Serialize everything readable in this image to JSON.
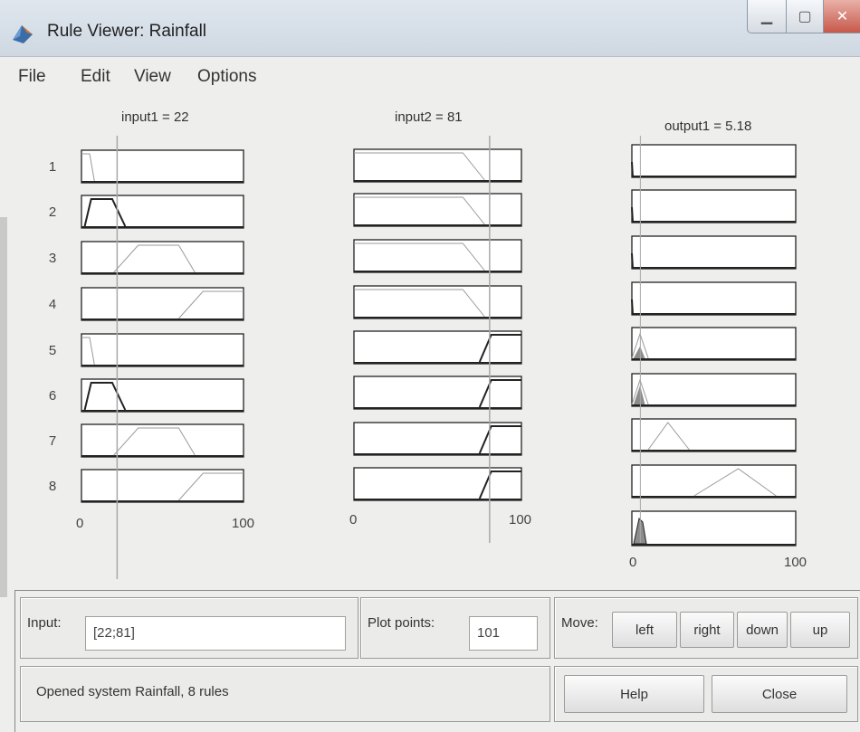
{
  "window": {
    "title": "Rule Viewer: Rainfall"
  },
  "menu": [
    "File",
    "Edit",
    "View",
    "Options"
  ],
  "inputs": [
    {
      "title": "input1 = 22",
      "value": 22
    },
    {
      "title": "input2 = 81",
      "value": 81
    }
  ],
  "output": {
    "title": "output1 = 5.18",
    "value": 5.18
  },
  "rule_numbers": [
    "1",
    "2",
    "3",
    "4",
    "5",
    "6",
    "7",
    "8"
  ],
  "axis": {
    "min": "0",
    "max": "100"
  },
  "controls": {
    "input_label": "Input:",
    "input_value": "[22;81]",
    "plot_points_label": "Plot points:",
    "plot_points_value": "101",
    "move_label": "Move:",
    "left": "left",
    "right": "right",
    "down": "down",
    "up": "up",
    "help": "Help",
    "close": "Close"
  },
  "status": "Opened system Rainfall, 8 rules",
  "colors": {
    "line": "#222222",
    "faint": "#9a9a9a",
    "fill": "#8c8c8c",
    "cursor": "#a8a8a8"
  }
}
